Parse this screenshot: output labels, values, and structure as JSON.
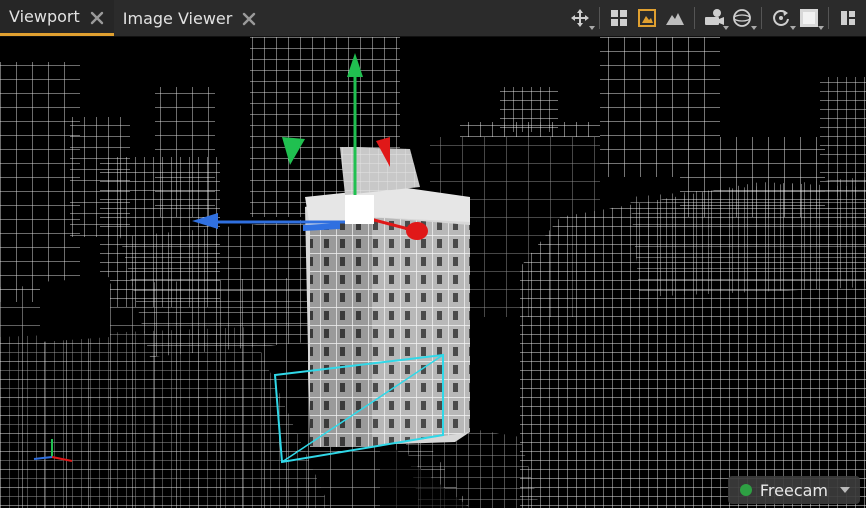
{
  "tabs": [
    {
      "label": "Viewport",
      "active": true
    },
    {
      "label": "Image Viewer",
      "active": false
    }
  ],
  "toolbar": {
    "icons": [
      "move-icon",
      "grid-layout-icon",
      "image-frame-icon",
      "terrain-icon",
      "camera-settings-icon",
      "material-sphere-icon",
      "rotate-icon",
      "render-square-icon",
      "split-panel-icon"
    ]
  },
  "camera": {
    "label": "Freecam",
    "status_color": "#2ea043"
  },
  "colors": {
    "accent_tab": "#e0a030",
    "gizmo_x": "#e01818",
    "gizmo_y": "#20c050",
    "gizmo_z": "#3070e0",
    "selection": "#30d8e8"
  }
}
